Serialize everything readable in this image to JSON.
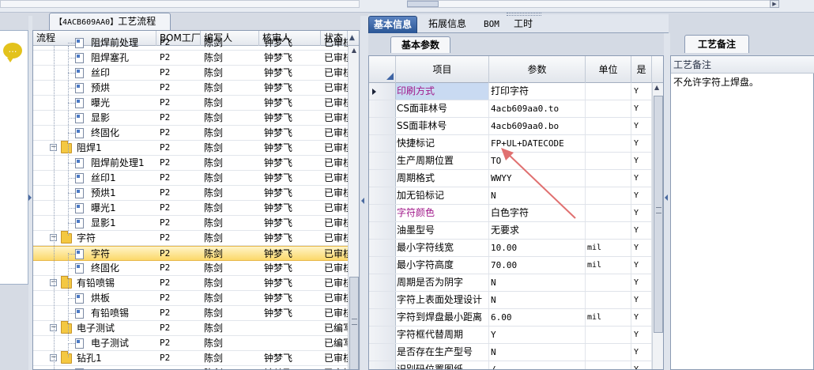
{
  "process_tab": {
    "code": "【4ACB609AA0】",
    "title": "工艺流程"
  },
  "left_panel": {
    "icon": "comment-icon"
  },
  "tree": {
    "columns": [
      "流程",
      "BOM工厂",
      "编写人",
      "核审人",
      "状态"
    ],
    "rows": [
      {
        "label": "阻焊前处理",
        "bom": "P2",
        "author": "陈剑",
        "reviewer": "钟梦飞",
        "status": "已审核",
        "type": "file",
        "level": 2
      },
      {
        "label": "阻焊塞孔",
        "bom": "P2",
        "author": "陈剑",
        "reviewer": "钟梦飞",
        "status": "已审核",
        "type": "file",
        "level": 2
      },
      {
        "label": "丝印",
        "bom": "P2",
        "author": "陈剑",
        "reviewer": "钟梦飞",
        "status": "已审核",
        "type": "file",
        "level": 2
      },
      {
        "label": "预烘",
        "bom": "P2",
        "author": "陈剑",
        "reviewer": "钟梦飞",
        "status": "已审核",
        "type": "file",
        "level": 2
      },
      {
        "label": "曝光",
        "bom": "P2",
        "author": "陈剑",
        "reviewer": "钟梦飞",
        "status": "已审核",
        "type": "file",
        "level": 2
      },
      {
        "label": "显影",
        "bom": "P2",
        "author": "陈剑",
        "reviewer": "钟梦飞",
        "status": "已审核",
        "type": "file",
        "level": 2
      },
      {
        "label": "终固化",
        "bom": "P2",
        "author": "陈剑",
        "reviewer": "钟梦飞",
        "status": "已审核",
        "type": "file",
        "level": 2
      },
      {
        "label": "阻焊1",
        "bom": "P2",
        "author": "陈剑",
        "reviewer": "钟梦飞",
        "status": "已审核",
        "type": "folder",
        "level": 1
      },
      {
        "label": "阻焊前处理1",
        "bom": "P2",
        "author": "陈剑",
        "reviewer": "钟梦飞",
        "status": "已审核",
        "type": "file",
        "level": 2
      },
      {
        "label": "丝印1",
        "bom": "P2",
        "author": "陈剑",
        "reviewer": "钟梦飞",
        "status": "已审核",
        "type": "file",
        "level": 2
      },
      {
        "label": "预烘1",
        "bom": "P2",
        "author": "陈剑",
        "reviewer": "钟梦飞",
        "status": "已审核",
        "type": "file",
        "level": 2
      },
      {
        "label": "曝光1",
        "bom": "P2",
        "author": "陈剑",
        "reviewer": "钟梦飞",
        "status": "已审核",
        "type": "file",
        "level": 2
      },
      {
        "label": "显影1",
        "bom": "P2",
        "author": "陈剑",
        "reviewer": "钟梦飞",
        "status": "已审核",
        "type": "file",
        "level": 2
      },
      {
        "label": "字符",
        "bom": "P2",
        "author": "陈剑",
        "reviewer": "钟梦飞",
        "status": "已审核",
        "type": "folder",
        "level": 1
      },
      {
        "label": "字符",
        "bom": "P2",
        "author": "陈剑",
        "reviewer": "钟梦飞",
        "status": "已审核",
        "type": "file",
        "level": 2,
        "selected": true
      },
      {
        "label": "终固化",
        "bom": "P2",
        "author": "陈剑",
        "reviewer": "钟梦飞",
        "status": "已审核",
        "type": "file",
        "level": 2
      },
      {
        "label": "有铅喷锡",
        "bom": "P2",
        "author": "陈剑",
        "reviewer": "钟梦飞",
        "status": "已审核",
        "type": "folder",
        "level": 1
      },
      {
        "label": "烘板",
        "bom": "P2",
        "author": "陈剑",
        "reviewer": "钟梦飞",
        "status": "已审核",
        "type": "file",
        "level": 2
      },
      {
        "label": "有铅喷锡",
        "bom": "P2",
        "author": "陈剑",
        "reviewer": "钟梦飞",
        "status": "已审核",
        "type": "file",
        "level": 2
      },
      {
        "label": "电子测试",
        "bom": "P2",
        "author": "陈剑",
        "reviewer": "",
        "status": "已编写",
        "type": "folder",
        "level": 1
      },
      {
        "label": "电子测试",
        "bom": "P2",
        "author": "陈剑",
        "reviewer": "",
        "status": "已编写",
        "type": "file",
        "level": 2
      },
      {
        "label": "钻孔1",
        "bom": "P2",
        "author": "陈剑",
        "reviewer": "钟梦飞",
        "status": "已审核",
        "type": "folder",
        "level": 1
      },
      {
        "label": "",
        "bom": "P2",
        "author": "陈剑",
        "reviewer": "钟梦飞",
        "status": "已审核",
        "type": "file",
        "level": 2
      }
    ]
  },
  "tabs": [
    {
      "label": "基本信息",
      "active": true
    },
    {
      "label": "拓展信息",
      "active": false
    },
    {
      "label": "BOM",
      "active": false
    },
    {
      "label": "工时",
      "active": false
    }
  ],
  "subtab": {
    "label": "基本参数"
  },
  "grid": {
    "columns": [
      "项目",
      "参数",
      "单位",
      "是"
    ],
    "rows": [
      {
        "item": "印刷方式",
        "param": "打印字符",
        "unit": "",
        "flag": "Y",
        "pink": true,
        "current": true
      },
      {
        "item": "CS面菲林号",
        "param": "4acb609aa0.to",
        "unit": "",
        "flag": "Y",
        "mono": true
      },
      {
        "item": "SS面菲林号",
        "param": "4acb609aa0.bo",
        "unit": "",
        "flag": "Y",
        "mono": true
      },
      {
        "item": "快捷标记",
        "param": "FP+UL+DATECODE",
        "unit": "",
        "flag": "Y",
        "mono": true
      },
      {
        "item": "生产周期位置",
        "param": "TO",
        "unit": "",
        "flag": "Y",
        "mono": true
      },
      {
        "item": "周期格式",
        "param": "WWYY",
        "unit": "",
        "flag": "Y",
        "mono": true
      },
      {
        "item": "加无铅标记",
        "param": "N",
        "unit": "",
        "flag": "Y",
        "mono": true
      },
      {
        "item": "字符颜色",
        "param": "白色字符",
        "unit": "",
        "flag": "Y",
        "pink": true
      },
      {
        "item": "油墨型号",
        "param": "无要求",
        "unit": "",
        "flag": "Y"
      },
      {
        "item": "最小字符线宽",
        "param": "10.00",
        "unit": "mil",
        "flag": "Y",
        "mono": true
      },
      {
        "item": "最小字符高度",
        "param": "70.00",
        "unit": "mil",
        "flag": "Y",
        "mono": true
      },
      {
        "item": "周期是否为阴字",
        "param": "N",
        "unit": "",
        "flag": "Y",
        "mono": true
      },
      {
        "item": "字符上表面处理设计",
        "param": "N",
        "unit": "",
        "flag": "Y",
        "mono": true
      },
      {
        "item": "字符到焊盘最小距离",
        "param": "6.00",
        "unit": "mil",
        "flag": "Y",
        "mono": true
      },
      {
        "item": "字符框代替周期",
        "param": "Y",
        "unit": "",
        "flag": "Y",
        "mono": true
      },
      {
        "item": "是否存在生产型号",
        "param": "N",
        "unit": "",
        "flag": "Y",
        "mono": true
      },
      {
        "item": "识别码位置图纸",
        "param": "/",
        "unit": "",
        "flag": "Y",
        "mono": true
      }
    ]
  },
  "notes": {
    "tab_label": "工艺备注",
    "header": "工艺备注",
    "text": "不允许字符上焊盘。"
  },
  "colors": {
    "accent": "#2a5696",
    "selection": "#fbd86a",
    "pink_label": "#a0188a",
    "annotation_arrow": "#e07070",
    "folder": "#f4c842"
  }
}
